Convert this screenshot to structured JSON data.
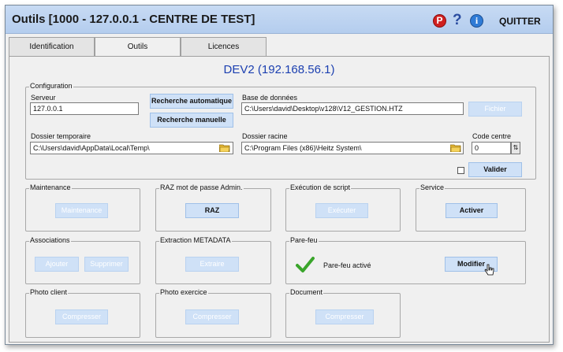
{
  "window": {
    "title": "Outils [1000 - 127.0.0.1 - CENTRE DE TEST]",
    "quit_label": "QUITTER",
    "icons": [
      "pdf-icon",
      "help-icon",
      "info-icon"
    ]
  },
  "tabs": [
    {
      "label": "Identification",
      "active": false
    },
    {
      "label": "Outils",
      "active": true
    },
    {
      "label": "Licences",
      "active": false
    }
  ],
  "server_title": "DEV2 (192.168.56.1)",
  "configuration": {
    "label": "Configuration",
    "server_label": "Serveur",
    "server_value": "127.0.0.1",
    "auto_search_label": "Recherche automatique",
    "manual_search_label": "Recherche manuelle",
    "database_label": "Base de données",
    "database_value": "C:\\Users\\david\\Desktop\\v128\\V12_GESTION.HTZ",
    "file_button_label": "Fichier",
    "temp_folder_label": "Dossier temporaire",
    "temp_folder_value": "C:\\Users\\david\\AppData\\Local\\Temp\\",
    "root_folder_label": "Dossier racine",
    "root_folder_value": "C:\\Program Files (x86)\\Heitz System\\",
    "center_code_label": "Code centre",
    "center_code_value": "0",
    "validate_label": "Valider"
  },
  "groups": {
    "maintenance": {
      "label": "Maintenance",
      "button": "Maintenance"
    },
    "raz": {
      "label": "RAZ mot de passe Admin.",
      "button": "RAZ"
    },
    "script": {
      "label": "Exécution de script",
      "button": "Exécuter"
    },
    "service": {
      "label": "Service",
      "button": "Activer"
    },
    "associations": {
      "label": "Associations",
      "add_button": "Ajouter",
      "delete_button": "Supprimer"
    },
    "metadata": {
      "label": "Extraction METADATA",
      "button": "Extraire"
    },
    "firewall": {
      "label": "Pare-feu",
      "status": "Pare-feu activé",
      "button": "Modifier"
    },
    "photo_client": {
      "label": "Photo client",
      "button": "Compresser"
    },
    "photo_exercise": {
      "label": "Photo exercice",
      "button": "Compresser"
    },
    "document": {
      "label": "Document",
      "button": "Compresser"
    }
  },
  "colors": {
    "titlebar": "#b4cdee",
    "button_bg": "#cfe1f7",
    "server_title": "#1b3fb0",
    "check_green": "#3aa52b"
  }
}
